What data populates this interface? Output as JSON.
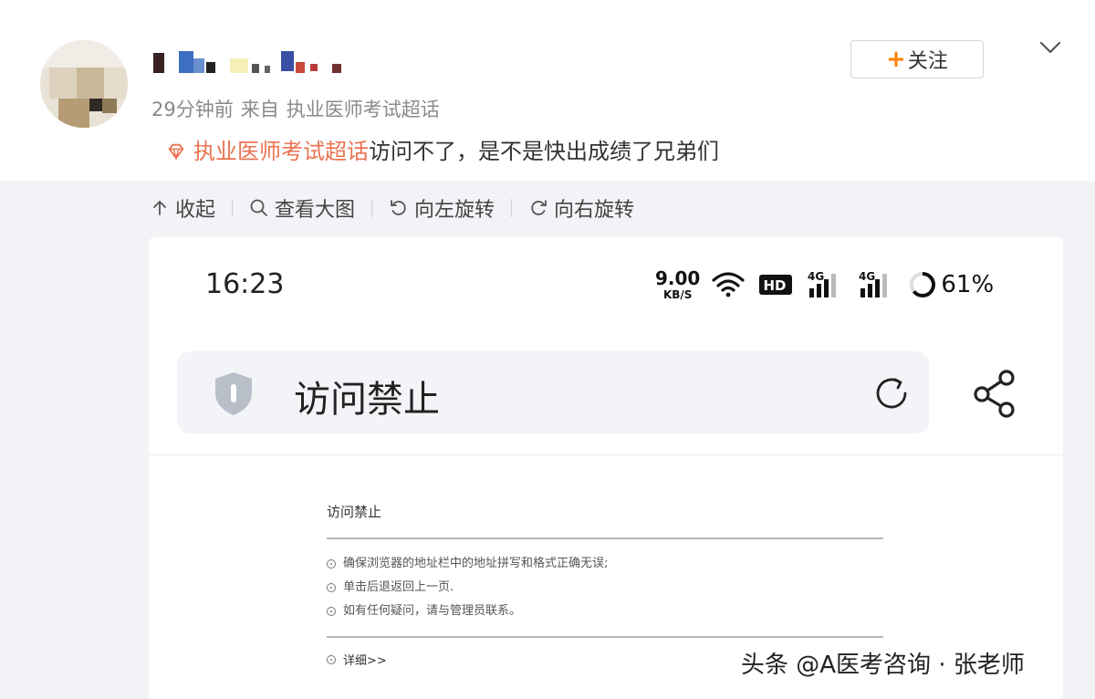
{
  "post": {
    "meta_time": "29分钟前",
    "meta_from": "来自",
    "meta_source": "执业医师考试超话",
    "topic_tag": "执业医师考试超话",
    "content_text": "访问不了，是不是快出成绩了兄弟们",
    "follow_label": "关注",
    "follow_plus": "+"
  },
  "toolbar": {
    "collapse": "收起",
    "view_large": "查看大图",
    "rotate_left": "向左旋转",
    "rotate_right": "向右旋转"
  },
  "phone": {
    "time": "16:23",
    "net_speed_value": "9.00",
    "net_speed_unit": "KB/S",
    "hd_label": "HD",
    "signal1_label": "4G",
    "signal2_label": "4G",
    "battery": "61%",
    "address_title": "访问禁止"
  },
  "error_page": {
    "heading": "访问禁止",
    "items": [
      "确保浏览器的地址栏中的地址拼写和格式正确无误;",
      "单击后退返回上一页.",
      "如有任何疑问，请与管理员联系。"
    ],
    "more": "详细>>"
  },
  "watermark": "头条 @A医考咨询 · 张老师",
  "colors": {
    "accent_orange": "#ff8200",
    "topic_red": "#eb7350"
  }
}
